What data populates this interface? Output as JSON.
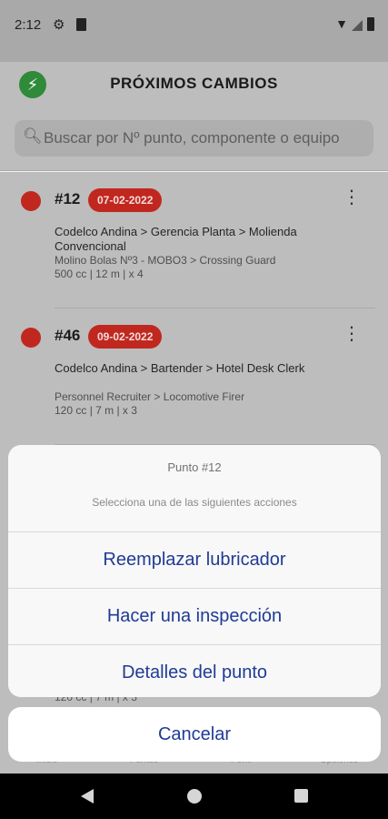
{
  "status_bar": {
    "time": "2:12",
    "icons": [
      "gear-icon",
      "sd-card-icon",
      "wifi-icon",
      "cell-signal-icon",
      "battery-icon"
    ]
  },
  "header": {
    "title": "PRÓXIMOS CAMBIOS",
    "logo_icon": "lightning-bolt-icon",
    "logo_color": "#2f8a3a"
  },
  "search": {
    "placeholder": "Buscar por Nº punto, componente o equipo",
    "icon": "search-icon"
  },
  "items": [
    {
      "number": "#12",
      "date": "07-02-2022",
      "status_color": "#c0281f",
      "path": "Codelco Andina > Gerencia Planta > Molienda Convencional",
      "component": "Molino Bolas Nº3 - MOBO3 > Crossing Guard",
      "specs": "500 cc | 12 m | x 4"
    },
    {
      "number": "#46",
      "date": "09-02-2022",
      "status_color": "#c0281f",
      "path": "Codelco Andina > Bartender > Hotel Desk Clerk",
      "component": "Personnel Recruiter > Locomotive Firer",
      "specs": "120 cc | 7 m | x 3"
    },
    {
      "number": "",
      "date": "",
      "status_color": "#c0281f",
      "path": "",
      "component": "",
      "specs": "120 cc | 7 m | x 3"
    }
  ],
  "tabs": [
    "Inicio",
    "Puntos",
    "Perfil",
    "Opciones"
  ],
  "action_sheet": {
    "title": "Punto #12",
    "message": "Selecciona una de las siguientes acciones",
    "actions": [
      "Reemplazar lubricador",
      "Hacer una inspección",
      "Detalles del punto"
    ],
    "cancel_label": "Cancelar",
    "accent_color": "#1f3b95"
  },
  "nav_bar": {
    "icons": [
      "back-icon",
      "home-icon",
      "recent-apps-icon"
    ]
  }
}
